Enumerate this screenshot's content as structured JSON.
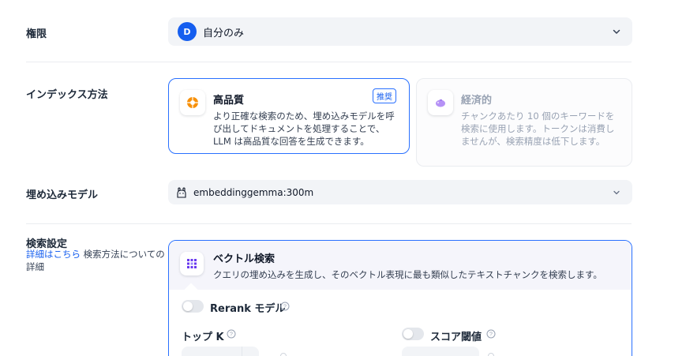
{
  "permission": {
    "label": "権限",
    "avatar_letter": "D",
    "value": "自分のみ"
  },
  "index_method": {
    "label": "インデックス方法",
    "high_quality": {
      "title": "高品質",
      "badge": "推奨",
      "description": "より正確な検索のため、埋め込みモデルを呼び出してドキュメントを処理することで、LLM は高品質な回答を生成できます。"
    },
    "economy": {
      "title": "経済的",
      "description": "チャンクあたり 10 個のキーワードを検索に使用します。トークンは消費しませんが、検索精度は低下します。"
    }
  },
  "embedding": {
    "label": "埋め込みモデル",
    "value": "embeddinggemma:300m"
  },
  "retrieval": {
    "label": "検索設定",
    "help_link": "詳細はこちら",
    "help_suffix": " 検索方法についての詳細",
    "vector": {
      "title": "ベクトル検索",
      "description": "クエリの埋め込みを生成し、そのベクトル表現に最も類似したテキストチャンクを検索します。"
    },
    "rerank_label": "Rerank モデル",
    "topk_label": "トップ K",
    "score_label": "スコア閾値"
  },
  "colors": {
    "accent": "#155eef",
    "border_selected": "#2970ff",
    "field_bg": "#f2f4f7"
  }
}
